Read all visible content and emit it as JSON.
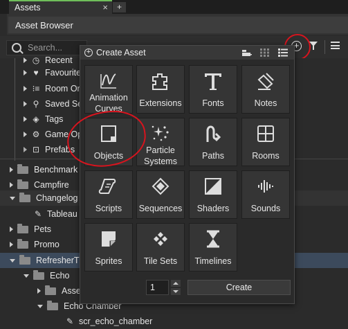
{
  "tabs": {
    "assets_label": "Assets",
    "close_glyph": "×",
    "add_glyph": "+"
  },
  "header": {
    "title": "Asset Browser"
  },
  "search": {
    "placeholder": "Search..."
  },
  "toolbar": {
    "add_glyph": "+",
    "add_icon": "plus-circle-icon",
    "filter_icon": "filter-icon",
    "menu_icon": "menu-icon"
  },
  "tree": {
    "rows": [
      {
        "label": "Recent",
        "icon": "clock-icon"
      },
      {
        "label": "Favourites",
        "icon": "heart-icon"
      },
      {
        "label": "Room Order",
        "icon": "room-order-icon"
      },
      {
        "label": "Saved Searches",
        "icon": "search-icon"
      },
      {
        "label": "Tags",
        "icon": "tag-icon"
      },
      {
        "label": "Game Options",
        "icon": "gear-icon"
      },
      {
        "label": "Prefabs",
        "icon": "prefab-icon"
      },
      {
        "label": "Benchmark",
        "icon": "folder-icon"
      },
      {
        "label": "Campfire",
        "icon": "folder-icon"
      },
      {
        "label": "Changelog",
        "icon": "folder-icon"
      },
      {
        "label": "Tableau",
        "icon": "pen-icon"
      },
      {
        "label": "Pets",
        "icon": "folder-icon"
      },
      {
        "label": "Promo",
        "icon": "folder-icon"
      },
      {
        "label": "RefresherT",
        "icon": "folder-icon"
      },
      {
        "label": "Echo",
        "icon": "folder-icon"
      },
      {
        "label": "Assets",
        "icon": "folder-icon"
      },
      {
        "label": "Echo Chamber",
        "icon": "folder-icon"
      },
      {
        "label": "scr_echo_chamber",
        "icon": "script-icon"
      }
    ]
  },
  "create_asset": {
    "title": "Create Asset",
    "tiles": [
      {
        "label": "Animation Curves",
        "icon": "animation-curve-icon"
      },
      {
        "label": "Extensions",
        "icon": "puzzle-icon"
      },
      {
        "label": "Fonts",
        "icon": "font-icon"
      },
      {
        "label": "Notes",
        "icon": "note-icon"
      },
      {
        "label": "Objects",
        "icon": "object-icon"
      },
      {
        "label": "Particle Systems",
        "icon": "particle-icon"
      },
      {
        "label": "Paths",
        "icon": "path-icon"
      },
      {
        "label": "Rooms",
        "icon": "room-icon"
      },
      {
        "label": "Scripts",
        "icon": "script-icon"
      },
      {
        "label": "Sequences",
        "icon": "sequence-icon"
      },
      {
        "label": "Shaders",
        "icon": "shader-icon"
      },
      {
        "label": "Sounds",
        "icon": "sound-icon"
      },
      {
        "label": "Sprites",
        "icon": "sprite-icon"
      },
      {
        "label": "Tile Sets",
        "icon": "tileset-icon"
      },
      {
        "label": "Timelines",
        "icon": "timeline-icon"
      }
    ],
    "quantity": "1",
    "create_label": "Create"
  },
  "colors": {
    "accent_tab": "#6fbf5a",
    "annotation_red": "#d8141e",
    "selected_row": "#3c4a5c"
  }
}
